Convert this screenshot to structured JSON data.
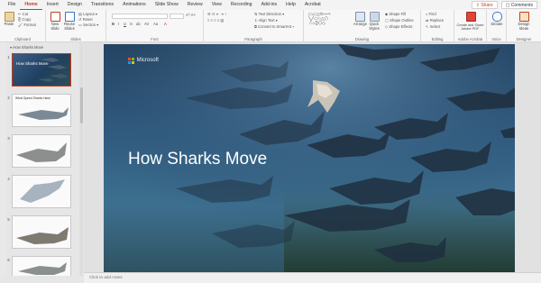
{
  "menu": {
    "tabs": [
      "File",
      "Home",
      "Insert",
      "Design",
      "Transitions",
      "Animations",
      "Slide Show",
      "Review",
      "View",
      "Recording",
      "Add-ins",
      "Help",
      "Acrobat"
    ],
    "active_tab": "Home",
    "share_label": "Share",
    "comments_label": "Comments"
  },
  "ribbon": {
    "clipboard": {
      "paste": "Paste",
      "label": "Clipboard"
    },
    "slides": {
      "new_slide": "New Slide",
      "reuse_slides": "Reuse Slides",
      "layout": "Layout",
      "reset": "Reset",
      "section": "Section",
      "label": "Slides"
    },
    "font": {
      "label": "Font"
    },
    "paragraph": {
      "text_direction": "Text Direction",
      "align_text": "Align Text",
      "convert_smartart": "Convert to SmartArt",
      "label": "Paragraph"
    },
    "drawing": {
      "arrange": "Arrange",
      "quick_styles": "Quick Styles",
      "shape_fill": "Shape Fill",
      "shape_outline": "Shape Outline",
      "shape_effects": "Shape Effects",
      "label": "Drawing"
    },
    "editing": {
      "find": "Find",
      "replace": "Replace",
      "select": "Select",
      "label": "Editing"
    },
    "adobe": {
      "create_share": "Create and Share Adobe PDF",
      "label": "Adobe Acrobat"
    },
    "voice": {
      "dictate": "Dictate",
      "label": "Voice"
    },
    "designer": {
      "design_ideas": "Design Ideas",
      "label": "Designer"
    }
  },
  "panel": {
    "section_title": "How Sharks Move",
    "thumbnails": [
      {
        "num": "1",
        "text": "How Sharks Move"
      },
      {
        "num": "2",
        "text": "What Speed Sharks Have"
      },
      {
        "num": "3",
        "text": ""
      },
      {
        "num": "4",
        "text": ""
      },
      {
        "num": "5",
        "text": ""
      },
      {
        "num": "6",
        "text": ""
      }
    ]
  },
  "slide": {
    "logo_text": "Microsoft",
    "title": "How Sharks Move"
  },
  "notes_placeholder": "Click to add notes",
  "colors": {
    "accent": "#c43e1c",
    "ms_red": "#f25022",
    "ms_green": "#7fba00",
    "ms_blue": "#00a4ef",
    "ms_yellow": "#ffb900"
  }
}
